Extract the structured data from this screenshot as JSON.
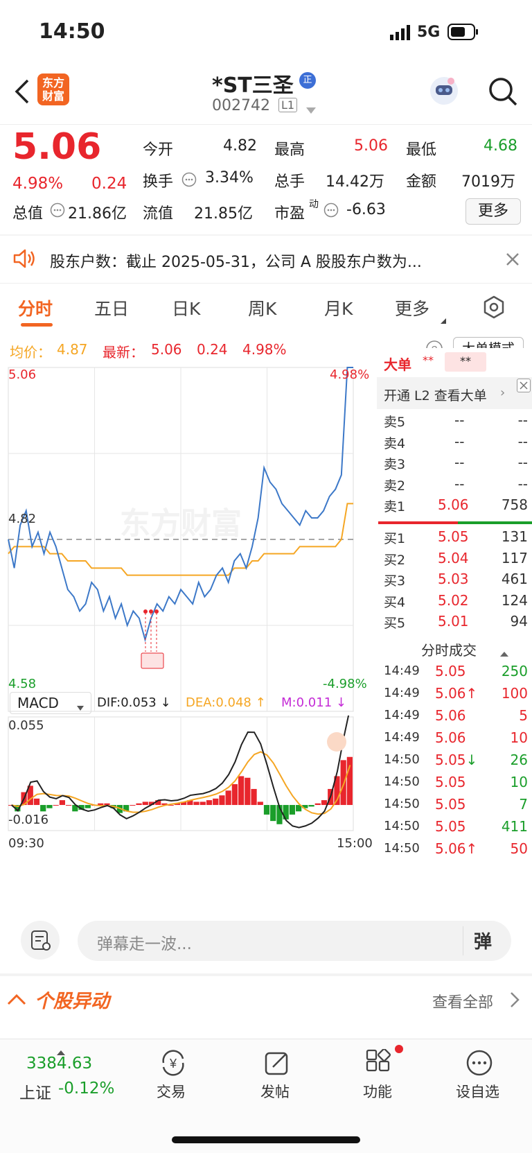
{
  "status_bar": {
    "time": "14:50",
    "network": "5G"
  },
  "header": {
    "logo_text": [
      "东方",
      "财富"
    ],
    "stock_name": "*ST三圣",
    "badge": "正",
    "code": "002742",
    "level": "L1"
  },
  "quote": {
    "price": "5.06",
    "pct": "4.98%",
    "chg": "0.24",
    "rows": [
      [
        {
          "k": "今开",
          "v": "4.82"
        },
        {
          "k": "最高",
          "v": "5.06",
          "c": "red"
        },
        {
          "k": "最低",
          "v": "4.68",
          "c": "green"
        }
      ],
      [
        {
          "k": "换手",
          "v": "3.34%"
        },
        {
          "k": "总手",
          "v": "14.42万"
        },
        {
          "k": "金额",
          "v": "7019万"
        }
      ],
      [
        {
          "k": "总值",
          "v": "21.86亿"
        },
        {
          "k": "流值",
          "v": "21.85亿"
        },
        {
          "k": "市盈",
          "sup": "动",
          "v": "-6.63"
        }
      ]
    ],
    "more_label": "更多"
  },
  "notice": {
    "text": "股东户数：截止 2025-05-31，公司 A 股股东户数为..."
  },
  "tabs": {
    "items": [
      "分时",
      "五日",
      "日K",
      "周K",
      "月K",
      "更多"
    ],
    "active": 0
  },
  "info_bar": {
    "avg_label": "均价：",
    "avg": "4.87",
    "last_label": "最新：",
    "last": "5.06",
    "chg": "0.24",
    "pct": "4.98%",
    "mode_btn": "大单模式"
  },
  "chart_data": [
    {
      "type": "line",
      "title": "",
      "ylim": [
        4.58,
        5.06
      ],
      "y_right_labels": [
        "4.98%",
        "-4.98%"
      ],
      "y_left_labels": [
        "5.06",
        "4.82",
        "4.58"
      ],
      "series": [],
      "price_curve": [
        4.82,
        4.78,
        4.84,
        4.86,
        4.81,
        4.83,
        4.8,
        4.83,
        4.81,
        4.78,
        4.75,
        4.74,
        4.72,
        4.73,
        4.76,
        4.75,
        4.72,
        4.74,
        4.71,
        4.73,
        4.7,
        4.72,
        4.71,
        4.68,
        4.71,
        4.73,
        4.72,
        4.74,
        4.73,
        4.75,
        4.74,
        4.73,
        4.76,
        4.74,
        4.75,
        4.77,
        4.78,
        4.76,
        4.79,
        4.8,
        4.78,
        4.81,
        4.85,
        4.92,
        4.9,
        4.89,
        4.87,
        4.86,
        4.85,
        4.84,
        4.86,
        4.85,
        4.85,
        4.86,
        4.88,
        4.89,
        4.91,
        5.06,
        5.06
      ],
      "avg_curve": [
        4.8,
        4.81,
        4.81,
        4.81,
        4.81,
        4.81,
        4.81,
        4.8,
        4.8,
        4.8,
        4.79,
        4.79,
        4.79,
        4.79,
        4.78,
        4.78,
        4.78,
        4.78,
        4.78,
        4.78,
        4.77,
        4.77,
        4.77,
        4.77,
        4.77,
        4.77,
        4.77,
        4.77,
        4.77,
        4.77,
        4.77,
        4.77,
        4.77,
        4.77,
        4.77,
        4.77,
        4.77,
        4.77,
        4.78,
        4.78,
        4.78,
        4.79,
        4.79,
        4.8,
        4.8,
        4.8,
        4.8,
        4.8,
        4.8,
        4.81,
        4.81,
        4.81,
        4.81,
        4.81,
        4.81,
        4.81,
        4.82,
        4.87,
        4.87
      ],
      "x_labels": [
        "09:30",
        "15:00"
      ],
      "watermark": "东方财富"
    },
    {
      "type": "bar",
      "title": "MACD",
      "indicators": [
        {
          "name": "DIF",
          "value": "0.053",
          "dir": "↓",
          "color": "#222"
        },
        {
          "name": "DEA",
          "value": "0.048",
          "dir": "↑",
          "color": "#f5a623"
        },
        {
          "name": "M",
          "value": "0.011",
          "dir": "↓",
          "color": "#c42bd6"
        }
      ],
      "ylim": [
        -0.016,
        0.055
      ],
      "y_labels": [
        "0.055",
        "-0.016"
      ],
      "macd": [
        0.0,
        -0.004,
        0.008,
        0.012,
        0.004,
        -0.004,
        -0.002,
        0.0,
        0.003,
        0.0,
        -0.004,
        -0.003,
        -0.002,
        0.0,
        0.001,
        0.001,
        -0.002,
        -0.005,
        -0.004,
        0.0,
        0.001,
        0.002,
        0.002,
        0.003,
        0.001,
        0.0,
        0.001,
        0.002,
        0.003,
        0.002,
        0.002,
        0.003,
        0.004,
        0.006,
        0.009,
        0.013,
        0.018,
        0.017,
        0.01,
        0.002,
        -0.006,
        -0.01,
        -0.012,
        -0.009,
        -0.006,
        -0.004,
        -0.002,
        -0.001,
        0.001,
        0.003,
        0.01,
        0.018,
        0.028,
        0.03
      ]
    }
  ],
  "orderbook": {
    "bigorder_label": "大单",
    "bigorder_mask": "**",
    "l2_label": "开通 L2 查看大单",
    "sells": [
      {
        "k": "卖5",
        "p": "--",
        "v": "--"
      },
      {
        "k": "卖4",
        "p": "--",
        "v": "--"
      },
      {
        "k": "卖3",
        "p": "--",
        "v": "--"
      },
      {
        "k": "卖2",
        "p": "--",
        "v": "--"
      },
      {
        "k": "卖1",
        "p": "5.06",
        "v": "758"
      }
    ],
    "buys": [
      {
        "k": "买1",
        "p": "5.05",
        "v": "131"
      },
      {
        "k": "买2",
        "p": "5.04",
        "v": "117"
      },
      {
        "k": "买3",
        "p": "5.03",
        "v": "461"
      },
      {
        "k": "买4",
        "p": "5.02",
        "v": "124"
      },
      {
        "k": "买5",
        "p": "5.01",
        "v": "94"
      }
    ],
    "ticks_title": "分时成交",
    "ticks": [
      {
        "t": "14:49",
        "p": "5.05",
        "v": "250",
        "c": "green"
      },
      {
        "t": "14:49",
        "p": "5.06↑",
        "v": "100",
        "c": "red"
      },
      {
        "t": "14:49",
        "p": "5.06",
        "v": "5",
        "c": "red"
      },
      {
        "t": "14:49",
        "p": "5.06",
        "v": "10",
        "c": "red"
      },
      {
        "t": "14:50",
        "p": "5.05↓",
        "v": "26",
        "c": "green"
      },
      {
        "t": "14:50",
        "p": "5.05",
        "v": "10",
        "c": "green"
      },
      {
        "t": "14:50",
        "p": "5.05",
        "v": "7",
        "c": "green"
      },
      {
        "t": "14:50",
        "p": "5.05",
        "v": "411",
        "c": "green"
      },
      {
        "t": "14:50",
        "p": "5.06↑",
        "v": "50",
        "c": "red"
      }
    ]
  },
  "comment": {
    "placeholder": "弹幕走一波...",
    "danmu": "弹"
  },
  "section": {
    "title": "个股异动",
    "view_all": "查看全部"
  },
  "bottom": {
    "index_value": "3384.63",
    "index_name": "上证",
    "index_pct": "-0.12%",
    "nav": [
      {
        "label": "交易"
      },
      {
        "label": "发帖"
      },
      {
        "label": "功能"
      },
      {
        "label": "设自选"
      }
    ]
  },
  "colors": {
    "up": "#e8262d",
    "down": "#1a9e2a",
    "avg": "#f5a623",
    "price_line": "#3c78c8",
    "accent": "#f26522"
  }
}
